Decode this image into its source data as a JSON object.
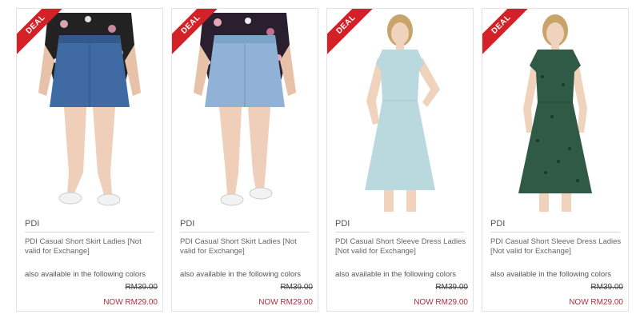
{
  "products": [
    {
      "badge": "DEAL",
      "brand": "PDI",
      "name": "PDI Casual Short Skirt Ladies [Not valid for Exchange]",
      "colors_note": "also available in the following colors",
      "old_price": "RM39.00",
      "now_price": "NOW RM29.00",
      "image": "denim-skirt-dark"
    },
    {
      "badge": "DEAL",
      "brand": "PDI",
      "name": "PDI Casual Short Skirt Ladies [Not valid for Exchange]",
      "colors_note": "also available in the following colors",
      "old_price": "RM39.00",
      "now_price": "NOW RM29.00",
      "image": "denim-skirt-light"
    },
    {
      "badge": "DEAL",
      "brand": "PDI",
      "name": "PDI Casual Short Sleeve Dress Ladies [Not valid for Exchange]",
      "colors_note": "also available in the following colors",
      "old_price": "RM39.00",
      "now_price": "NOW RM29.00",
      "image": "dress-light-blue"
    },
    {
      "badge": "DEAL",
      "brand": "PDI",
      "name": "PDI Casual Short Sleeve Dress Ladies [Not valid for Exchange]",
      "colors_note": "also available in the following colors",
      "old_price": "RM39.00",
      "now_price": "NOW RM29.00",
      "image": "dress-green-print"
    }
  ],
  "colors": {
    "deal_badge": "#d42027",
    "now_price": "#a3343f",
    "skirt_dark": "#3f6aa3",
    "skirt_light": "#8fb2d6",
    "dress_blue": "#b9d9de",
    "dress_green": "#2f5a45"
  }
}
